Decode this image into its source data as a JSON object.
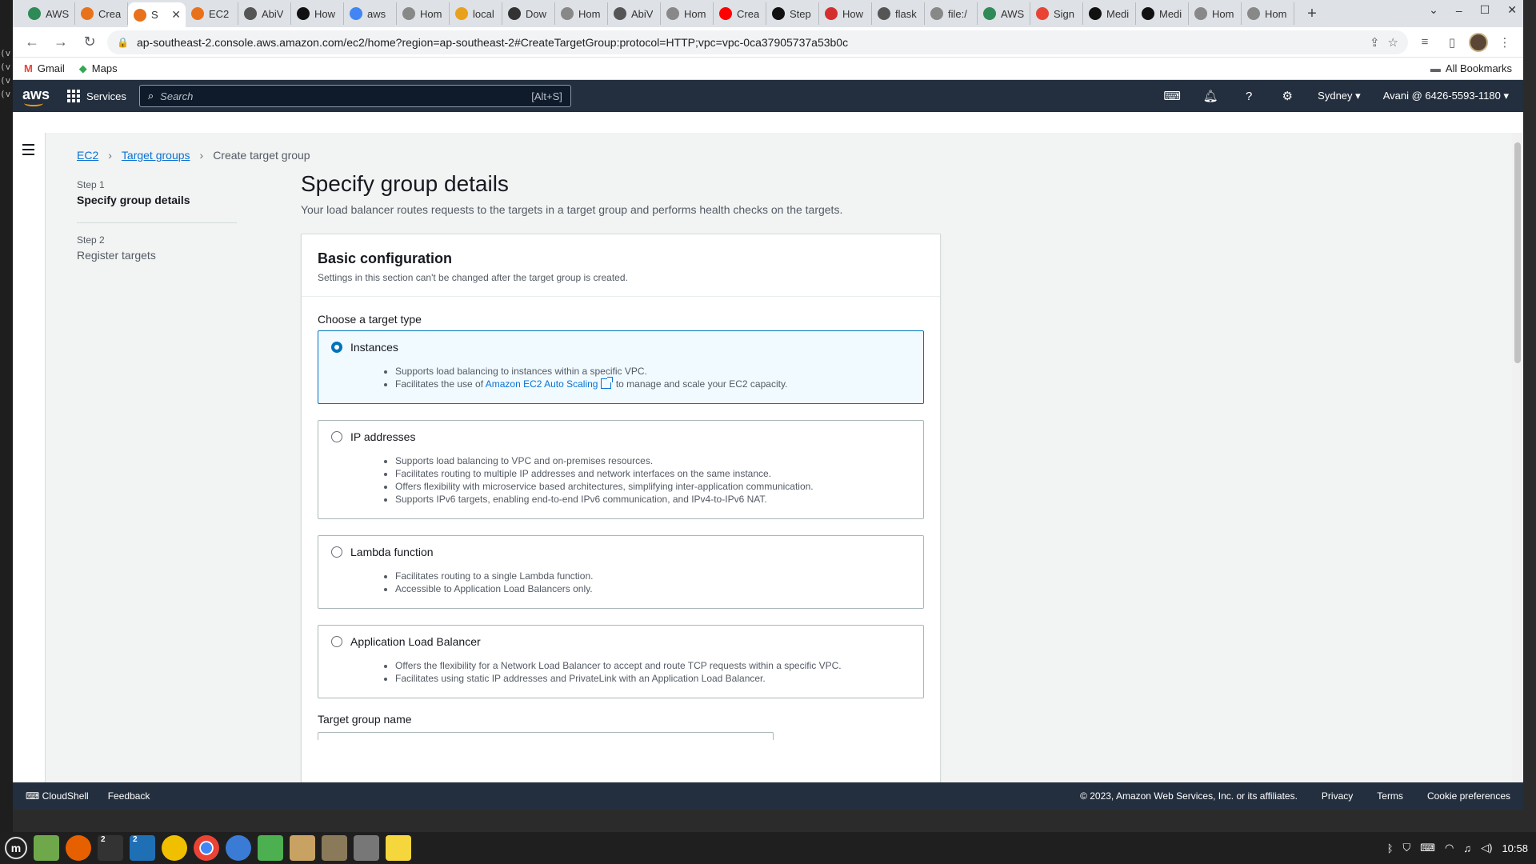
{
  "terminal_lines": [
    "(v",
    "(v",
    "(v",
    "(v"
  ],
  "tabs": [
    {
      "title": "AWS",
      "color": "#2e8b57"
    },
    {
      "title": "Crea",
      "color": "#e8721c"
    },
    {
      "title": "S",
      "color": "#e8721c",
      "active": true
    },
    {
      "title": "EC2 |",
      "color": "#e8721c"
    },
    {
      "title": "AbiV",
      "color": "#555"
    },
    {
      "title": "How",
      "color": "#111"
    },
    {
      "title": "aws",
      "color": "#4285f4"
    },
    {
      "title": "Hom",
      "color": "#888"
    },
    {
      "title": "local",
      "color": "#e8a11c"
    },
    {
      "title": "Dow",
      "color": "#333"
    },
    {
      "title": "Hom",
      "color": "#888"
    },
    {
      "title": "AbiV",
      "color": "#555"
    },
    {
      "title": "Hom",
      "color": "#888"
    },
    {
      "title": "Crea",
      "color": "#ff0000"
    },
    {
      "title": "Step",
      "color": "#111"
    },
    {
      "title": "How",
      "color": "#d32f2f"
    },
    {
      "title": "flask",
      "color": "#555"
    },
    {
      "title": "file:/",
      "color": "#888"
    },
    {
      "title": "AWS",
      "color": "#2e8b57"
    },
    {
      "title": "Sign",
      "color": "#ea4335"
    },
    {
      "title": "Medi",
      "color": "#111"
    },
    {
      "title": "Medi",
      "color": "#111"
    },
    {
      "title": "Hom",
      "color": "#888"
    },
    {
      "title": "Hom",
      "color": "#888"
    }
  ],
  "address": {
    "url": "ap-southeast-2.console.aws.amazon.com/ec2/home?region=ap-southeast-2#CreateTargetGroup:protocol=HTTP;vpc=vpc-0ca37905737a53b0c"
  },
  "bookmarks": {
    "gmail": "Gmail",
    "maps": "Maps",
    "all": "All Bookmarks"
  },
  "aws_header": {
    "logo": "aws",
    "services": "Services",
    "search_placeholder": "Search",
    "search_shortcut": "[Alt+S]",
    "region": "Sydney",
    "account": "Avani @ 6426-5593-1180"
  },
  "breadcrumb": {
    "ec2": "EC2",
    "target_groups": "Target groups",
    "current": "Create target group"
  },
  "steps": [
    {
      "label": "Step 1",
      "name": "Specify group details"
    },
    {
      "label": "Step 2",
      "name": "Register targets"
    }
  ],
  "page": {
    "title": "Specify group details",
    "description": "Your load balancer routes requests to the targets in a target group and performs health checks on the targets."
  },
  "basic_config": {
    "title": "Basic configuration",
    "subtitle": "Settings in this section can't be changed after the target group is created.",
    "target_type_label": "Choose a target type",
    "options": [
      {
        "name": "Instances",
        "selected": true,
        "bullets": [
          "Supports load balancing to instances within a specific VPC."
        ],
        "link_prefix": "Facilitates the use of ",
        "link_text": "Amazon EC2 Auto Scaling",
        "link_suffix": " to manage and scale your EC2 capacity."
      },
      {
        "name": "IP addresses",
        "selected": false,
        "bullets": [
          "Supports load balancing to VPC and on-premises resources.",
          "Facilitates routing to multiple IP addresses and network interfaces on the same instance.",
          "Offers flexibility with microservice based architectures, simplifying inter-application communication.",
          "Supports IPv6 targets, enabling end-to-end IPv6 communication, and IPv4-to-IPv6 NAT."
        ]
      },
      {
        "name": "Lambda function",
        "selected": false,
        "bullets": [
          "Facilitates routing to a single Lambda function.",
          "Accessible to Application Load Balancers only."
        ]
      },
      {
        "name": "Application Load Balancer",
        "selected": false,
        "bullets": [
          "Offers the flexibility for a Network Load Balancer to accept and route TCP requests within a specific VPC.",
          "Facilitates using static IP addresses and PrivateLink with an Application Load Balancer."
        ]
      }
    ],
    "target_group_name_label": "Target group name"
  },
  "footer": {
    "cloudshell": "CloudShell",
    "feedback": "Feedback",
    "copyright": "© 2023, Amazon Web Services, Inc. or its affiliates.",
    "privacy": "Privacy",
    "terms": "Terms",
    "cookies": "Cookie preferences"
  },
  "taskbar": {
    "badge_terminal": "2",
    "badge_vscode": "2",
    "clock": "10:58"
  },
  "colors": {
    "aws_nav": "#232f3e",
    "link": "#0972d3",
    "selected_border": "#0073bb",
    "selected_bg": "#f1faff"
  }
}
